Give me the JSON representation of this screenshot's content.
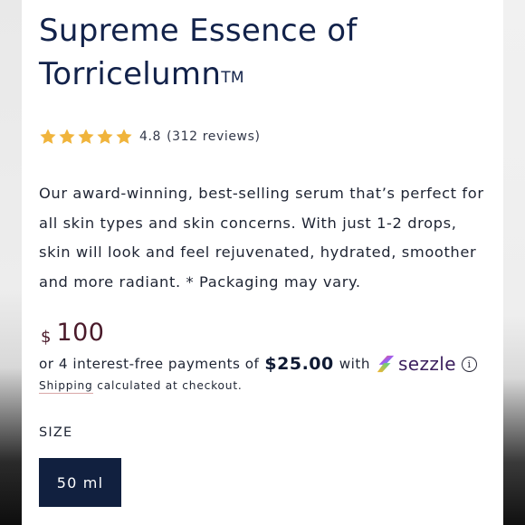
{
  "product": {
    "title": "Supreme Essence of Torricelumn",
    "trademark": "TM"
  },
  "rating": {
    "value": "4.8",
    "count_text": "(312 reviews)",
    "stars": 5,
    "star_color": "#f0b43c"
  },
  "description": "Our award-winning, best-selling serum that’s perfect for all skin types and skin concerns. With just 1-2 drops, skin will look and feel rejuvenated, hydrated, smoother and more radiant. * Packaging may vary.",
  "price": {
    "currency": "$",
    "amount": "100"
  },
  "installments": {
    "prefix": "or 4 interest-free payments of",
    "amount": "$25.00",
    "with": "with",
    "provider": "sezzle",
    "info_symbol": "i"
  },
  "shipping": {
    "link": "Shipping",
    "text": "calculated at checkout."
  },
  "size": {
    "label": "SIZE",
    "selected": "50 ml"
  },
  "colors": {
    "title": "#12224a",
    "price": "#4a1a2a",
    "button_bg": "#11203f",
    "sezzle": "#3b1f5e",
    "shipping_underline": "#d9a7a7"
  }
}
